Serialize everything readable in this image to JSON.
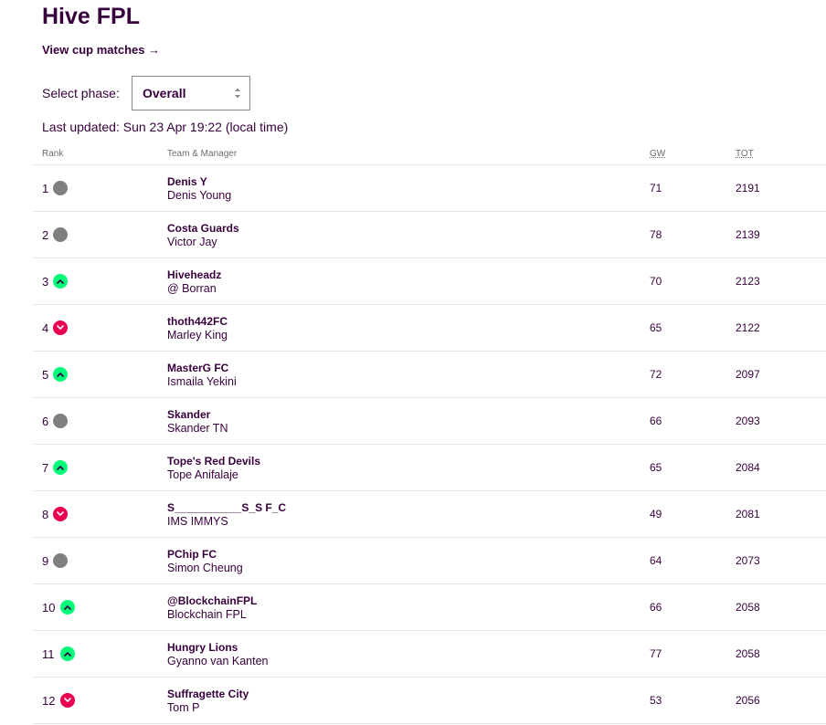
{
  "header": {
    "title": "Hive FPL",
    "cup_link": "View cup matches →"
  },
  "phase": {
    "label": "Select phase:",
    "selected": "Overall"
  },
  "last_updated": "Last updated: Sun 23 Apr 19:22 (local time)",
  "columns": {
    "rank": "Rank",
    "team": "Team & Manager",
    "gw": "GW",
    "tot": "TOT"
  },
  "colors": {
    "text": "#37003c",
    "up": "#01fc7a",
    "down": "#e90052",
    "same": "#7f7f7f"
  },
  "standings": [
    {
      "rank": "1",
      "movement": "same",
      "team": "Denis Y",
      "manager": "Denis Young",
      "gw": "71",
      "tot": "2191"
    },
    {
      "rank": "2",
      "movement": "same",
      "team": "Costa Guards",
      "manager": "Victor Jay",
      "gw": "78",
      "tot": "2139"
    },
    {
      "rank": "3",
      "movement": "up",
      "team": "Hiveheadz",
      "manager": "@ Borran",
      "gw": "70",
      "tot": "2123"
    },
    {
      "rank": "4",
      "movement": "down",
      "team": "thoth442FC",
      "manager": "Marley King",
      "gw": "65",
      "tot": "2122"
    },
    {
      "rank": "5",
      "movement": "up",
      "team": "MasterG FC",
      "manager": "Ismaila Yekini",
      "gw": "72",
      "tot": "2097"
    },
    {
      "rank": "6",
      "movement": "same",
      "team": "Skander",
      "manager": "Skander TN",
      "gw": "66",
      "tot": "2093"
    },
    {
      "rank": "7",
      "movement": "up",
      "team": "Tope's Red Devils",
      "manager": "Tope Anifalaje",
      "gw": "65",
      "tot": "2084"
    },
    {
      "rank": "8",
      "movement": "down",
      "team": "S___________S_S F_C",
      "manager": "IMS IMMYS",
      "gw": "49",
      "tot": "2081"
    },
    {
      "rank": "9",
      "movement": "same",
      "team": "PChip FC",
      "manager": "Simon Cheung",
      "gw": "64",
      "tot": "2073"
    },
    {
      "rank": "10",
      "movement": "up",
      "team": "@BlockchainFPL",
      "manager": "Blockchain FPL",
      "gw": "66",
      "tot": "2058"
    },
    {
      "rank": "11",
      "movement": "up",
      "team": "Hungry Lions",
      "manager": "Gyanno van Kanten",
      "gw": "77",
      "tot": "2058"
    },
    {
      "rank": "12",
      "movement": "down",
      "team": "Suffragette City",
      "manager": "Tom P",
      "gw": "53",
      "tot": "2056"
    }
  ]
}
